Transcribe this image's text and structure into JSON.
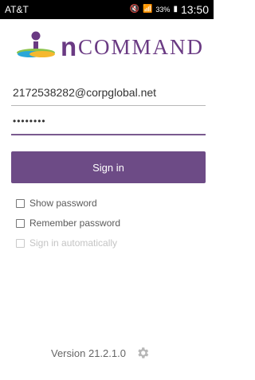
{
  "status_bar": {
    "carrier": "AT&T",
    "battery": "33%",
    "time": "13:50"
  },
  "logo": {
    "text_n": "n",
    "text_command": "COMMAND"
  },
  "form": {
    "email_value": "2172538282@corpglobal.net",
    "password_value": "••••••••",
    "sign_in_label": "Sign in"
  },
  "options": [
    {
      "label": "Show password",
      "enabled": true
    },
    {
      "label": "Remember password",
      "enabled": true
    },
    {
      "label": "Sign in automatically",
      "enabled": false
    }
  ],
  "footer": {
    "version": "Version 21.2.1.0"
  },
  "colors": {
    "brand": "#6d4b86",
    "logo_text": "#6a3a83"
  }
}
